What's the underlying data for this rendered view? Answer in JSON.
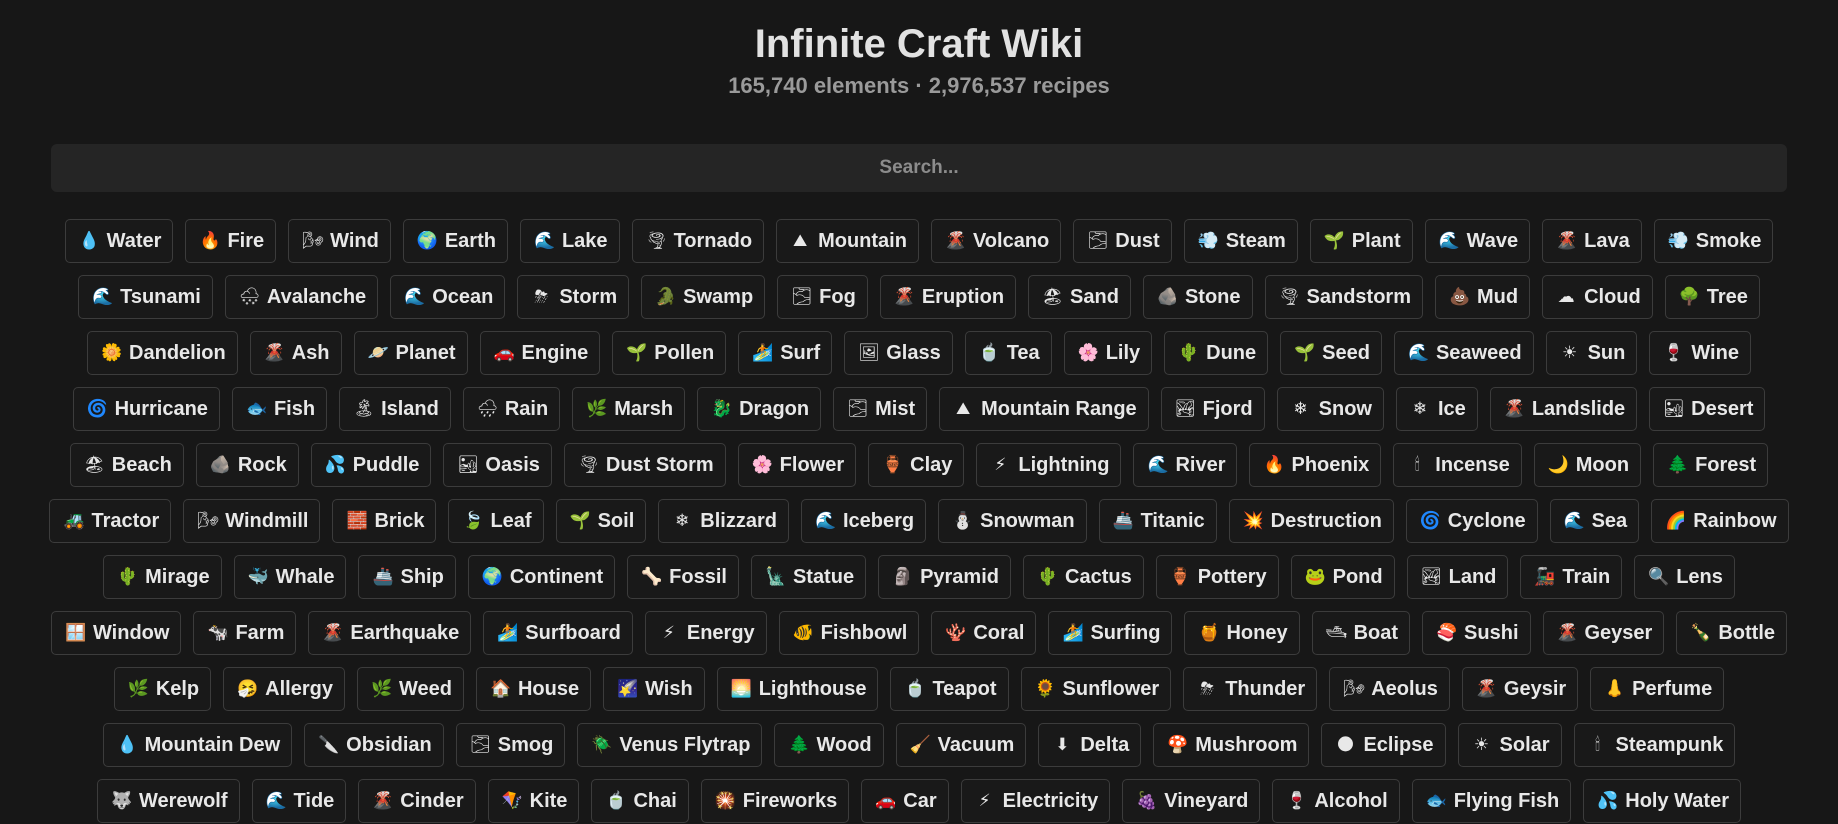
{
  "header": {
    "title": "Infinite Craft Wiki",
    "subtitle": "165,740 elements · 2,976,537 recipes"
  },
  "search": {
    "placeholder": "Search..."
  },
  "rows": [
    [
      {
        "label": "Water",
        "icon": "💧",
        "icon_name": "water-drop"
      },
      {
        "label": "Fire",
        "icon": "🔥",
        "icon_name": "fire"
      },
      {
        "label": "Wind",
        "icon": "🌬",
        "icon_name": "wind-face"
      },
      {
        "label": "Earth",
        "icon": "🌍",
        "icon_name": "globe"
      },
      {
        "label": "Lake",
        "icon": "🌊",
        "icon_name": "wave"
      },
      {
        "label": "Tornado",
        "icon": "🌪",
        "icon_name": "tornado"
      },
      {
        "label": "Mountain",
        "icon": "⛰",
        "icon_name": "mountain"
      },
      {
        "label": "Volcano",
        "icon": "🌋",
        "icon_name": "volcano"
      },
      {
        "label": "Dust",
        "icon": "🌫",
        "icon_name": "fog"
      },
      {
        "label": "Steam",
        "icon": "💨",
        "icon_name": "dash"
      },
      {
        "label": "Plant",
        "icon": "🌱",
        "icon_name": "seedling"
      },
      {
        "label": "Wave",
        "icon": "🌊",
        "icon_name": "wave"
      },
      {
        "label": "Lava",
        "icon": "🌋",
        "icon_name": "volcano"
      },
      {
        "label": "Smoke",
        "icon": "💨",
        "icon_name": "dash"
      }
    ],
    [
      {
        "label": "Tsunami",
        "icon": "🌊",
        "icon_name": "wave"
      },
      {
        "label": "Avalanche",
        "icon": "🌨",
        "icon_name": "snow-cloud"
      },
      {
        "label": "Ocean",
        "icon": "🌊",
        "icon_name": "wave"
      },
      {
        "label": "Storm",
        "icon": "⛈",
        "icon_name": "storm-cloud"
      },
      {
        "label": "Swamp",
        "icon": "🐊",
        "icon_name": "crocodile"
      },
      {
        "label": "Fog",
        "icon": "🌫",
        "icon_name": "fog"
      },
      {
        "label": "Eruption",
        "icon": "🌋",
        "icon_name": "volcano"
      },
      {
        "label": "Sand",
        "icon": "🏖",
        "icon_name": "beach"
      },
      {
        "label": "Stone",
        "icon": "🪨",
        "icon_name": "rock"
      },
      {
        "label": "Sandstorm",
        "icon": "🌪",
        "icon_name": "tornado"
      },
      {
        "label": "Mud",
        "icon": "💩",
        "icon_name": "mud-pile"
      },
      {
        "label": "Cloud",
        "icon": "☁",
        "icon_name": "cloud"
      },
      {
        "label": "Tree",
        "icon": "🌳",
        "icon_name": "tree"
      }
    ],
    [
      {
        "label": "Dandelion",
        "icon": "🌼",
        "icon_name": "blossom"
      },
      {
        "label": "Ash",
        "icon": "🌋",
        "icon_name": "volcano"
      },
      {
        "label": "Planet",
        "icon": "🪐",
        "icon_name": "ringed-planet"
      },
      {
        "label": "Engine",
        "icon": "🚗",
        "icon_name": "car"
      },
      {
        "label": "Pollen",
        "icon": "🌱",
        "icon_name": "seedling"
      },
      {
        "label": "Surf",
        "icon": "🏄",
        "icon_name": "surfer"
      },
      {
        "label": "Glass",
        "icon": "🖼",
        "icon_name": "framed-picture"
      },
      {
        "label": "Tea",
        "icon": "🍵",
        "icon_name": "tea-cup"
      },
      {
        "label": "Lily",
        "icon": "🌸",
        "icon_name": "cherry-blossom"
      },
      {
        "label": "Dune",
        "icon": "🌵",
        "icon_name": "cactus"
      },
      {
        "label": "Seed",
        "icon": "🌱",
        "icon_name": "seedling"
      },
      {
        "label": "Seaweed",
        "icon": "🌊",
        "icon_name": "wave"
      },
      {
        "label": "Sun",
        "icon": "☀",
        "icon_name": "sun"
      },
      {
        "label": "Wine",
        "icon": "🍷",
        "icon_name": "wine-glass"
      }
    ],
    [
      {
        "label": "Hurricane",
        "icon": "🌀",
        "icon_name": "cyclone"
      },
      {
        "label": "Fish",
        "icon": "🐟",
        "icon_name": "fish"
      },
      {
        "label": "Island",
        "icon": "🏝",
        "icon_name": "island"
      },
      {
        "label": "Rain",
        "icon": "🌧",
        "icon_name": "rain-cloud"
      },
      {
        "label": "Marsh",
        "icon": "🌿",
        "icon_name": "herb"
      },
      {
        "label": "Dragon",
        "icon": "🐉",
        "icon_name": "dragon"
      },
      {
        "label": "Mist",
        "icon": "🌫",
        "icon_name": "fog"
      },
      {
        "label": "Mountain Range",
        "icon": "⛰",
        "icon_name": "mountain"
      },
      {
        "label": "Fjord",
        "icon": "🏞",
        "icon_name": "national-park"
      },
      {
        "label": "Snow",
        "icon": "❄",
        "icon_name": "snowflake"
      },
      {
        "label": "Ice",
        "icon": "❄",
        "icon_name": "snowflake"
      },
      {
        "label": "Landslide",
        "icon": "🌋",
        "icon_name": "volcano"
      },
      {
        "label": "Desert",
        "icon": "🏜",
        "icon_name": "desert"
      }
    ],
    [
      {
        "label": "Beach",
        "icon": "🏖",
        "icon_name": "beach"
      },
      {
        "label": "Rock",
        "icon": "🪨",
        "icon_name": "rock"
      },
      {
        "label": "Puddle",
        "icon": "💦",
        "icon_name": "droplets"
      },
      {
        "label": "Oasis",
        "icon": "🏜",
        "icon_name": "desert"
      },
      {
        "label": "Dust Storm",
        "icon": "🌪",
        "icon_name": "tornado"
      },
      {
        "label": "Flower",
        "icon": "🌸",
        "icon_name": "cherry-blossom"
      },
      {
        "label": "Clay",
        "icon": "🏺",
        "icon_name": "amphora"
      },
      {
        "label": "Lightning",
        "icon": "⚡",
        "icon_name": "lightning-bolt"
      },
      {
        "label": "River",
        "icon": "🌊",
        "icon_name": "wave"
      },
      {
        "label": "Phoenix",
        "icon": "🔥",
        "icon_name": "fire"
      },
      {
        "label": "Incense",
        "icon": "🕯",
        "icon_name": "candle"
      },
      {
        "label": "Moon",
        "icon": "🌙",
        "icon_name": "crescent-moon"
      },
      {
        "label": "Forest",
        "icon": "🌲",
        "icon_name": "evergreen-tree"
      }
    ],
    [
      {
        "label": "Tractor",
        "icon": "🚜",
        "icon_name": "tractor"
      },
      {
        "label": "Windmill",
        "icon": "🌬",
        "icon_name": "wind-face"
      },
      {
        "label": "Brick",
        "icon": "🧱",
        "icon_name": "brick"
      },
      {
        "label": "Leaf",
        "icon": "🍃",
        "icon_name": "leaf"
      },
      {
        "label": "Soil",
        "icon": "🌱",
        "icon_name": "seedling"
      },
      {
        "label": "Blizzard",
        "icon": "❄",
        "icon_name": "snowflake"
      },
      {
        "label": "Iceberg",
        "icon": "🌊",
        "icon_name": "wave"
      },
      {
        "label": "Snowman",
        "icon": "⛄",
        "icon_name": "snowman"
      },
      {
        "label": "Titanic",
        "icon": "🚢",
        "icon_name": "ship"
      },
      {
        "label": "Destruction",
        "icon": "💥",
        "icon_name": "explosion"
      },
      {
        "label": "Cyclone",
        "icon": "🌀",
        "icon_name": "cyclone"
      },
      {
        "label": "Sea",
        "icon": "🌊",
        "icon_name": "wave"
      },
      {
        "label": "Rainbow",
        "icon": "🌈",
        "icon_name": "rainbow"
      }
    ],
    [
      {
        "label": "Mirage",
        "icon": "🌵",
        "icon_name": "cactus"
      },
      {
        "label": "Whale",
        "icon": "🐳",
        "icon_name": "whale"
      },
      {
        "label": "Ship",
        "icon": "🚢",
        "icon_name": "ship"
      },
      {
        "label": "Continent",
        "icon": "🌍",
        "icon_name": "globe"
      },
      {
        "label": "Fossil",
        "icon": "🦴",
        "icon_name": "bone"
      },
      {
        "label": "Statue",
        "icon": "🗽",
        "icon_name": "statue-of-liberty"
      },
      {
        "label": "Pyramid",
        "icon": "🗿",
        "icon_name": "moai"
      },
      {
        "label": "Cactus",
        "icon": "🌵",
        "icon_name": "cactus"
      },
      {
        "label": "Pottery",
        "icon": "🏺",
        "icon_name": "amphora"
      },
      {
        "label": "Pond",
        "icon": "🐸",
        "icon_name": "frog"
      },
      {
        "label": "Land",
        "icon": "🏞",
        "icon_name": "national-park"
      },
      {
        "label": "Train",
        "icon": "🚂",
        "icon_name": "locomotive"
      },
      {
        "label": "Lens",
        "icon": "🔍",
        "icon_name": "magnifier"
      }
    ],
    [
      {
        "label": "Window",
        "icon": "🪟",
        "icon_name": "window"
      },
      {
        "label": "Farm",
        "icon": "🐄",
        "icon_name": "cow"
      },
      {
        "label": "Earthquake",
        "icon": "🌋",
        "icon_name": "volcano"
      },
      {
        "label": "Surfboard",
        "icon": "🏄",
        "icon_name": "surfer"
      },
      {
        "label": "Energy",
        "icon": "⚡",
        "icon_name": "lightning-bolt"
      },
      {
        "label": "Fishbowl",
        "icon": "🐠",
        "icon_name": "tropical-fish"
      },
      {
        "label": "Coral",
        "icon": "🪸",
        "icon_name": "coral"
      },
      {
        "label": "Surfing",
        "icon": "🏄",
        "icon_name": "surfer"
      },
      {
        "label": "Honey",
        "icon": "🍯",
        "icon_name": "honey-pot"
      },
      {
        "label": "Boat",
        "icon": "🛥",
        "icon_name": "boat"
      },
      {
        "label": "Sushi",
        "icon": "🍣",
        "icon_name": "sushi"
      },
      {
        "label": "Geyser",
        "icon": "🌋",
        "icon_name": "volcano"
      },
      {
        "label": "Bottle",
        "icon": "🍾",
        "icon_name": "bottle"
      }
    ],
    [
      {
        "label": "Kelp",
        "icon": "🌿",
        "icon_name": "herb"
      },
      {
        "label": "Allergy",
        "icon": "🤧",
        "icon_name": "sneezing-face"
      },
      {
        "label": "Weed",
        "icon": "🌿",
        "icon_name": "herb"
      },
      {
        "label": "House",
        "icon": "🏠",
        "icon_name": "house"
      },
      {
        "label": "Wish",
        "icon": "🌠",
        "icon_name": "shooting-star"
      },
      {
        "label": "Lighthouse",
        "icon": "🌅",
        "icon_name": "sunrise"
      },
      {
        "label": "Teapot",
        "icon": "🍵",
        "icon_name": "tea-cup"
      },
      {
        "label": "Sunflower",
        "icon": "🌻",
        "icon_name": "sunflower"
      },
      {
        "label": "Thunder",
        "icon": "⛈",
        "icon_name": "storm-cloud"
      },
      {
        "label": "Aeolus",
        "icon": "🌬",
        "icon_name": "wind-face"
      },
      {
        "label": "Geysir",
        "icon": "🌋",
        "icon_name": "volcano"
      },
      {
        "label": "Perfume",
        "icon": "👃",
        "icon_name": "nose"
      }
    ],
    [
      {
        "label": "Mountain Dew",
        "icon": "💧",
        "icon_name": "water-drop"
      },
      {
        "label": "Obsidian",
        "icon": "🔪",
        "icon_name": "knife"
      },
      {
        "label": "Smog",
        "icon": "🌫",
        "icon_name": "fog"
      },
      {
        "label": "Venus Flytrap",
        "icon": "🪲",
        "icon_name": "beetle"
      },
      {
        "label": "Wood",
        "icon": "🌲",
        "icon_name": "evergreen-tree"
      },
      {
        "label": "Vacuum",
        "icon": "🧹",
        "icon_name": "broom"
      },
      {
        "label": "Delta",
        "icon": "⬇",
        "icon_name": "down-arrow"
      },
      {
        "label": "Mushroom",
        "icon": "🍄",
        "icon_name": "mushroom"
      },
      {
        "label": "Eclipse",
        "icon": "🌑",
        "icon_name": "new-moon"
      },
      {
        "label": "Solar",
        "icon": "☀",
        "icon_name": "sun"
      },
      {
        "label": "Steampunk",
        "icon": "🕯",
        "icon_name": "candle"
      }
    ],
    [
      {
        "label": "Werewolf",
        "icon": "🐺",
        "icon_name": "wolf"
      },
      {
        "label": "Tide",
        "icon": "🌊",
        "icon_name": "wave"
      },
      {
        "label": "Cinder",
        "icon": "🌋",
        "icon_name": "volcano"
      },
      {
        "label": "Kite",
        "icon": "🪁",
        "icon_name": "kite"
      },
      {
        "label": "Chai",
        "icon": "🍵",
        "icon_name": "tea-cup"
      },
      {
        "label": "Fireworks",
        "icon": "🎇",
        "icon_name": "sparkler"
      },
      {
        "label": "Car",
        "icon": "🚗",
        "icon_name": "car"
      },
      {
        "label": "Electricity",
        "icon": "⚡",
        "icon_name": "lightning-bolt"
      },
      {
        "label": "Vineyard",
        "icon": "🍇",
        "icon_name": "grapes"
      },
      {
        "label": "Alcohol",
        "icon": "🍷",
        "icon_name": "wine-glass"
      },
      {
        "label": "Flying Fish",
        "icon": "🐟",
        "icon_name": "fish"
      },
      {
        "label": "Holy Water",
        "icon": "💦",
        "icon_name": "droplets"
      }
    ]
  ]
}
